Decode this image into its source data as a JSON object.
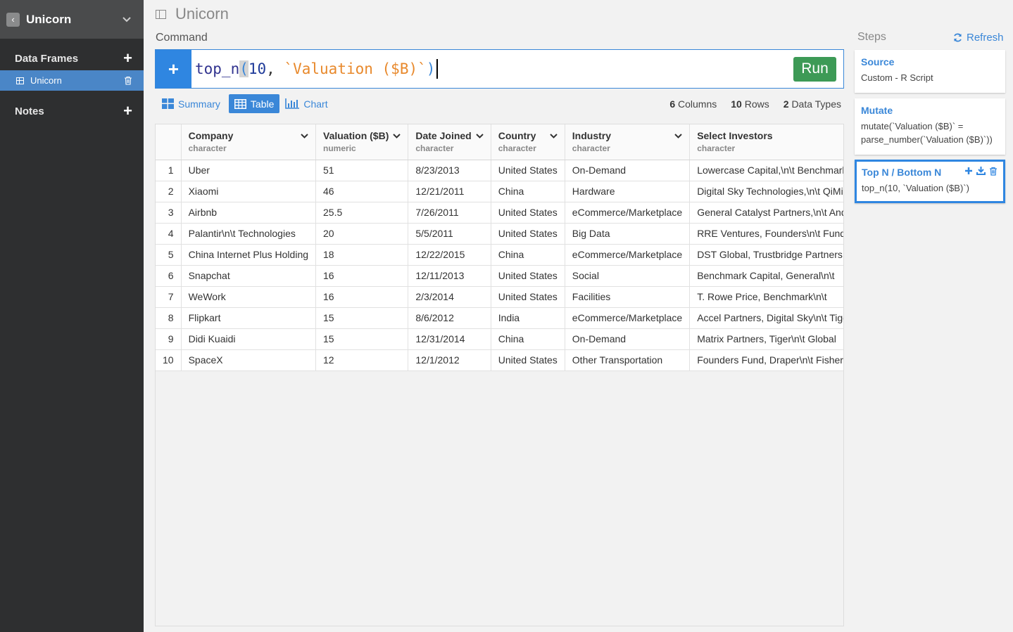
{
  "sidebar": {
    "title": "Unicorn",
    "sections": {
      "data_frames": "Data Frames",
      "notes": "Notes"
    },
    "items": [
      {
        "label": "Unicorn"
      }
    ]
  },
  "main": {
    "title": "Unicorn",
    "command_label": "Command",
    "command": {
      "fn": "top_n",
      "open_paren": "(",
      "num": "10",
      "comma": ", ",
      "str": "`Valuation ($B)`",
      "close_paren": ")"
    },
    "run_label": "Run",
    "tabs": [
      {
        "label": "Summary",
        "icon": "summary-icon"
      },
      {
        "label": "Table",
        "icon": "table-icon"
      },
      {
        "label": "Chart",
        "icon": "chart-icon"
      }
    ],
    "stats": {
      "columns_count": "6",
      "columns_label": "Columns",
      "rows_count": "10",
      "rows_label": "Rows",
      "types_count": "2",
      "types_label": "Data Types"
    }
  },
  "table": {
    "columns": [
      {
        "name": "Company",
        "type": "character"
      },
      {
        "name": "Valuation ($B)",
        "type": "numeric"
      },
      {
        "name": "Date Joined",
        "type": "character"
      },
      {
        "name": "Country",
        "type": "character"
      },
      {
        "name": "Industry",
        "type": "character"
      },
      {
        "name": "Select Investors",
        "type": "character"
      }
    ],
    "rows": [
      [
        "1",
        "Uber",
        "51",
        "8/23/2013",
        "United States",
        "On-Demand",
        "Lowercase Capital,\\n\\t  Benchmark"
      ],
      [
        "2",
        "Xiaomi",
        "46",
        "12/21/2011",
        "China",
        "Hardware",
        "Digital Sky Technologies,\\n\\t  QiMing"
      ],
      [
        "3",
        "Airbnb",
        "25.5",
        "7/26/2011",
        "United States",
        "eCommerce/Marketplace",
        "General Catalyst Partners,\\n\\t  Andreessen"
      ],
      [
        "4",
        "Palantir\\n\\t  Technologies",
        "20",
        "5/5/2011",
        "United States",
        "Big Data",
        "RRE Ventures, Founders\\n\\t  Fund"
      ],
      [
        "5",
        "China Internet Plus Holding",
        "18",
        "12/22/2015",
        "China",
        "eCommerce/Marketplace",
        "DST Global, Trustbridge Partners"
      ],
      [
        "6",
        "Snapchat",
        "16",
        "12/11/2013",
        "United States",
        "Social",
        "Benchmark Capital, General\\n\\t"
      ],
      [
        "7",
        "WeWork",
        "16",
        "2/3/2014",
        "United States",
        "Facilities",
        "T. Rowe Price, Benchmark\\n\\t"
      ],
      [
        "8",
        "Flipkart",
        "15",
        "8/6/2012",
        "India",
        "eCommerce/Marketplace",
        "Accel Partners, Digital Sky\\n\\t  Tiger"
      ],
      [
        "9",
        "Didi Kuaidi",
        "15",
        "12/31/2014",
        "China",
        "On-Demand",
        "Matrix Partners, Tiger\\n\\t  Global"
      ],
      [
        "10",
        "SpaceX",
        "12",
        "12/1/2012",
        "United States",
        "Other Transportation",
        "Founders Fund, Draper\\n\\t  Fisher"
      ]
    ]
  },
  "steps": {
    "label": "Steps",
    "refresh_label": "Refresh",
    "items": [
      {
        "title": "Source",
        "body": "Custom - R Script"
      },
      {
        "title": "Mutate",
        "body": "mutate(`Valuation ($B)` = parse_number(`Valuation ($B)`))"
      },
      {
        "title": "Top N / Bottom N",
        "body": "top_n(10, `Valuation ($B)`)"
      }
    ]
  },
  "colors": {
    "accent": "#3a87d8",
    "run": "#3d9a56",
    "sidebar_bg": "#2e2f30",
    "sidebar_header": "#4a4b4c"
  }
}
